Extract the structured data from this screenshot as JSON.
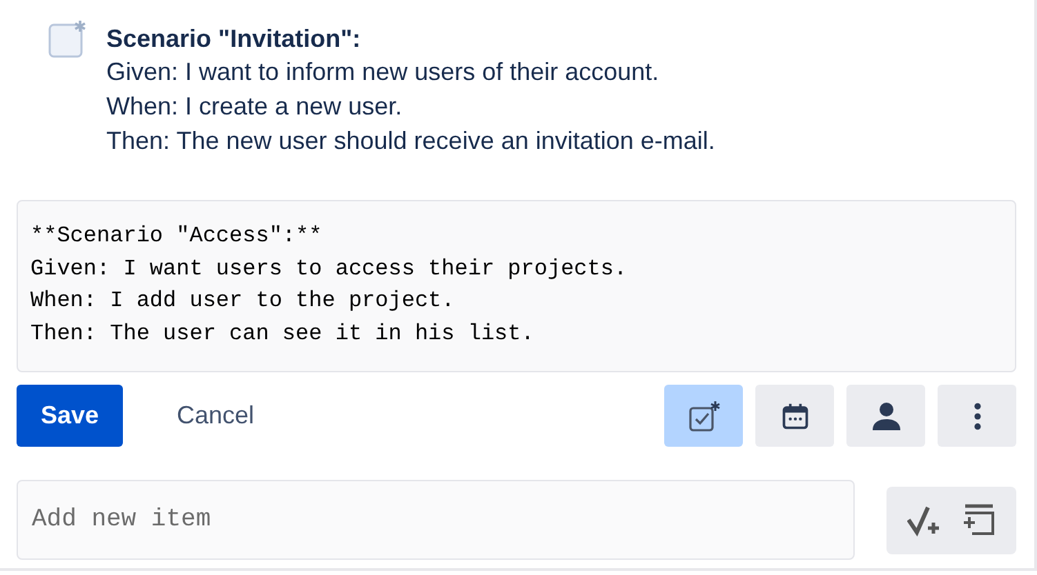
{
  "item": {
    "checked": false,
    "title": "Scenario \"Invitation\":",
    "lines": [
      "Given: I want to inform new users of their account.",
      "When: I create a new user.",
      "Then: The new user should receive an invitation e-mail."
    ]
  },
  "editor": {
    "value": "**Scenario \"Access\":**\nGiven: I want users to access their projects.\nWhen: I add user to the project.\nThen: The user can see it in his list."
  },
  "save": "Save",
  "cancel": "Cancel",
  "tools": [
    {
      "kind": "checkbox",
      "selected": true
    },
    {
      "kind": "calendar",
      "selected": false
    },
    {
      "kind": "person",
      "selected": false
    },
    {
      "kind": "more",
      "selected": false
    }
  ],
  "new_item": {
    "placeholder": "Add new item"
  }
}
